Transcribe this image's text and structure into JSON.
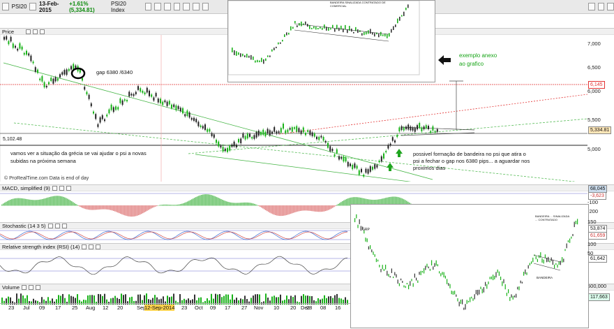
{
  "toolbar": {
    "symbol": "PSI20",
    "date": "13-Feb-2015",
    "change": "+1.61% (5,334.81)",
    "index_name": "PSI20 Index"
  },
  "panels": {
    "price": "Price",
    "macd": "MACD, simplified (9)",
    "stochastic": "Stochastic (14 3 5)",
    "rsi": "Relative strength index (RSI) (14)",
    "volume": "Volume"
  },
  "price_axis": [
    "7,000",
    "6,500",
    "6,000",
    "5,500",
    "5,000"
  ],
  "price_tags": {
    "red_level": "6,145",
    "current": "5,334.81",
    "left_level": "5,102.48"
  },
  "macd_axis": {
    "tag1": "68,045",
    "tag2": "-3,623",
    "v1": "-100",
    "v2": "-200"
  },
  "stoch_axis": [
    "80",
    "50"
  ],
  "rsi_axis": {
    "tag": "61,642"
  },
  "volume_axis": {
    "v1": "500,000",
    "tag": "117,663"
  },
  "inset_axis": {
    "tag1": "53,874",
    "tag2": "61,659",
    "v1": "150",
    "v2": "100",
    "v3": "50"
  },
  "annotations": {
    "gap": "gap 6380 /6340",
    "greece": "vamos ver a situação da grécia se vai ajudar o psi a novas subidas na próxima semana",
    "flag": "possivel formação de bandeira no psi que atira o psi a fechar o gap nos 6380 pips... a aguardar nos proximos dias",
    "example": "exemplo anexo ao grafico",
    "credit": "© ProRealTime.com  Data is end of day",
    "grp": "GRP",
    "bandeira": "BANDEIRA",
    "inset_note": "BANDEIRA ... SINALIZADA ... CONTRATADO",
    "top_inset_note": "BANDEIRA SINALIZADA CONTRATADO DE COMERCIAL"
  },
  "x_labels": [
    "23",
    "Jul",
    "09",
    "17",
    "25",
    "Aug",
    "12",
    "20",
    "Sep",
    "12-Sep-2014",
    "23",
    "Oct",
    "09",
    "17",
    "27",
    "Nov",
    "10",
    "20",
    "28",
    "Dec",
    "08",
    "16"
  ],
  "colors": {
    "up": "#19b219",
    "down": "#222222",
    "red_line": "#e33333",
    "green_line": "#42b442",
    "annotation_green": "#17a417"
  }
}
